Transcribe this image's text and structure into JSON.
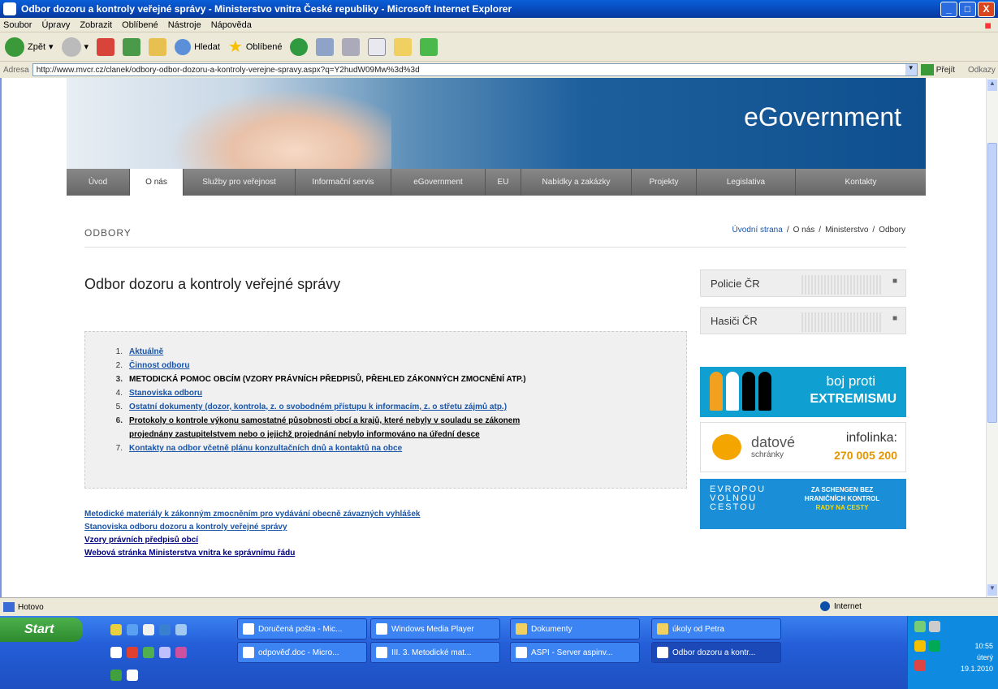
{
  "window": {
    "title": "Odbor dozoru a kontroly veřejné správy - Ministerstvo vnitra České republiky - Microsoft Internet Explorer",
    "buttons": [
      "_",
      "□",
      "X"
    ]
  },
  "menu": [
    "Soubor",
    "Úpravy",
    "Zobrazit",
    "Oblíbené",
    "Nástroje",
    "Nápověda"
  ],
  "toolbar": {
    "back": "Zpět",
    "search": "Hledat",
    "favorites": "Oblíbené"
  },
  "address": {
    "label": "Adresa",
    "url": "http://www.mvcr.cz/clanek/odbory-odbor-dozoru-a-kontroly-verejne-spravy.aspx?q=Y2hudW09Mw%3d%3d",
    "go": "Přejít",
    "links": "Odkazy"
  },
  "site": {
    "brand": "eGovernment",
    "nav": [
      "Úvod",
      "O nás",
      "Služby pro veřejnost",
      "Informační servis",
      "eGovernment",
      "EU",
      "Nabídky a zakázky",
      "Projekty",
      "Legislativa",
      "Kontakty"
    ],
    "section": "ODBORY",
    "breadcrumb": [
      "Úvodní strana",
      "O nás",
      "Ministerstvo",
      "Odbory"
    ],
    "heading": "Odbor dozoru a kontroly veřejné správy",
    "list": [
      {
        "n": "1.",
        "text": "Aktuálně"
      },
      {
        "n": "2.",
        "text": "Činnost odboru"
      },
      {
        "n": "3.",
        "text": "METODICKÁ POMOC OBCÍM (VZORY PRÁVNÍCH PŘEDPISŮ, PŘEHLED ZÁKONNÝCH ZMOCNĚNÍ ATP.)"
      },
      {
        "n": "4.",
        "text": "Stanoviska odboru"
      },
      {
        "n": "5.",
        "text": "Ostatní dokumenty (dozor, kontrola, z. o svobodném přístupu k informacím, z. o střetu zájmů atp.)"
      },
      {
        "n": "6.",
        "text": "Protokoly o kontrole výkonu samostatné působnosti obcí a krajů, které nebyly v souladu se zákonem"
      },
      {
        "n": "",
        "text": "projednány zastupitelstvem nebo o jejichž projednání nebylo informováno na úřední desce"
      },
      {
        "n": "7.",
        "text": "Kontakty na odbor včetně plánu konzultačních dnů a kontaktů na obce"
      }
    ],
    "bottom_links": [
      "Metodické materiály k zákonným zmocněním pro vydávání obecně závazných vyhlášek",
      "Stanoviska odboru dozoru a kontroly veřejné správy",
      "Vzory právních předpisů obcí",
      "Webová stránka Ministerstva vnitra ke správnímu řádu"
    ],
    "side": [
      "Policie ČR",
      "Hasiči ČR"
    ],
    "banner1": [
      "boj proti",
      "EXTREMISMU"
    ],
    "banner2": {
      "a": "datové",
      "b": "schránky",
      "c": "infolinka:",
      "d": "270 005 200"
    },
    "banner3": {
      "left": [
        "EVROPOU",
        "VOLNOU",
        "CESTOU"
      ],
      "right1": "ZA SCHENGEN BEZ",
      "right2": "HRANIČNÍCH KONTROL",
      "right3": "RADY NA CESTY"
    }
  },
  "status": {
    "left": "Hotovo",
    "zone": "Internet"
  },
  "taskbar": {
    "start": "Start",
    "tasks": [
      "Doručená pošta - Mic...",
      "Windows Media Player",
      "Dokumenty",
      "úkoly od Petra",
      "odpověď.doc - Micro...",
      "III. 3. Metodické mat...",
      "ASPI - Server aspinv...",
      "Odbor dozoru a kontr..."
    ],
    "clock": [
      "10:55",
      "úterý",
      "19.1.2010"
    ]
  }
}
